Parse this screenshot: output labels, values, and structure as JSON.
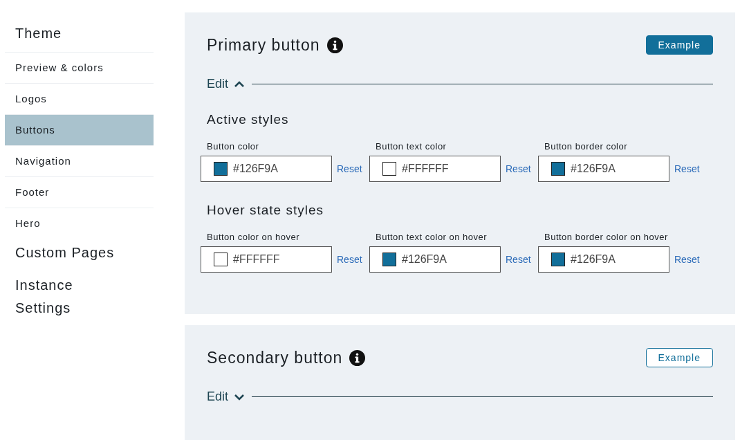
{
  "sidebar": {
    "sections": [
      {
        "title": "Theme",
        "items": [
          {
            "label": "Preview & colors",
            "selected": false
          },
          {
            "label": "Logos",
            "selected": false
          },
          {
            "label": "Buttons",
            "selected": true
          },
          {
            "label": "Navigation",
            "selected": false
          },
          {
            "label": "Footer",
            "selected": false
          },
          {
            "label": "Hero",
            "selected": false
          }
        ]
      },
      {
        "title": "Custom Pages"
      },
      {
        "title": "Instance Settings"
      }
    ]
  },
  "panels": [
    {
      "title": "Primary button",
      "example": {
        "label": "Example",
        "kind": "filled"
      },
      "edit": {
        "label": "Edit",
        "expanded": true
      },
      "groups": [
        {
          "title": "Active styles",
          "fields": [
            {
              "label": "Button color",
              "value": "#126F9A",
              "color": "#126f9a",
              "reset": "Reset"
            },
            {
              "label": "Button text color",
              "value": "#FFFFFF",
              "color": "#ffffff",
              "reset": "Reset"
            },
            {
              "label": "Button border color",
              "value": "#126F9A",
              "color": "#126f9a",
              "reset": "Reset"
            }
          ]
        },
        {
          "title": "Hover state styles",
          "fields": [
            {
              "label": "Button color on hover",
              "value": "#FFFFFF",
              "color": "#ffffff",
              "reset": "Reset"
            },
            {
              "label": "Button text color on hover",
              "value": "#126F9A",
              "color": "#126f9a",
              "reset": "Reset"
            },
            {
              "label": "Button border color on hover",
              "value": "#126F9A",
              "color": "#126f9a",
              "reset": "Reset"
            }
          ]
        }
      ]
    },
    {
      "title": "Secondary button",
      "example": {
        "label": "Example",
        "kind": "outline"
      },
      "edit": {
        "label": "Edit",
        "expanded": false
      }
    }
  ]
}
